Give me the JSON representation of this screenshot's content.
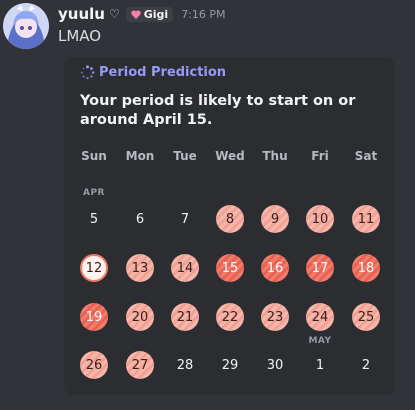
{
  "message": {
    "username": "yuulu",
    "badge_label": "Gigi",
    "timestamp": "7:16 PM",
    "text": "LMAO"
  },
  "embed": {
    "title": "Period Prediction",
    "description": "Your period is likely to start on or around April 15.",
    "weekdays": [
      "Sun",
      "Mon",
      "Tue",
      "Wed",
      "Thu",
      "Fri",
      "Sat"
    ],
    "month_labels": [
      "APR",
      "MAY"
    ],
    "days": [
      {
        "label": "5",
        "style": "plain"
      },
      {
        "label": "6",
        "style": "plain"
      },
      {
        "label": "7",
        "style": "plain"
      },
      {
        "label": "8",
        "style": "light"
      },
      {
        "label": "9",
        "style": "light"
      },
      {
        "label": "10",
        "style": "light"
      },
      {
        "label": "11",
        "style": "light"
      },
      {
        "label": "12",
        "style": "today"
      },
      {
        "label": "13",
        "style": "light"
      },
      {
        "label": "14",
        "style": "light"
      },
      {
        "label": "15",
        "style": "deep"
      },
      {
        "label": "16",
        "style": "deep"
      },
      {
        "label": "17",
        "style": "deep"
      },
      {
        "label": "18",
        "style": "deep"
      },
      {
        "label": "19",
        "style": "deep"
      },
      {
        "label": "20",
        "style": "light"
      },
      {
        "label": "21",
        "style": "light"
      },
      {
        "label": "22",
        "style": "light"
      },
      {
        "label": "23",
        "style": "light"
      },
      {
        "label": "24",
        "style": "light"
      },
      {
        "label": "25",
        "style": "light"
      },
      {
        "label": "26",
        "style": "light"
      },
      {
        "label": "27",
        "style": "light"
      },
      {
        "label": "28",
        "style": "plain"
      },
      {
        "label": "29",
        "style": "plain"
      },
      {
        "label": "30",
        "style": "plain"
      },
      {
        "label": "1",
        "style": "plain"
      },
      {
        "label": "2",
        "style": "plain"
      }
    ]
  },
  "colors": {
    "background": "#313338",
    "embed_background": "#2b2d31",
    "title_accent": "#949cf7",
    "light_day": "#f5b6ac",
    "deep_day": "#ef7c6c"
  }
}
